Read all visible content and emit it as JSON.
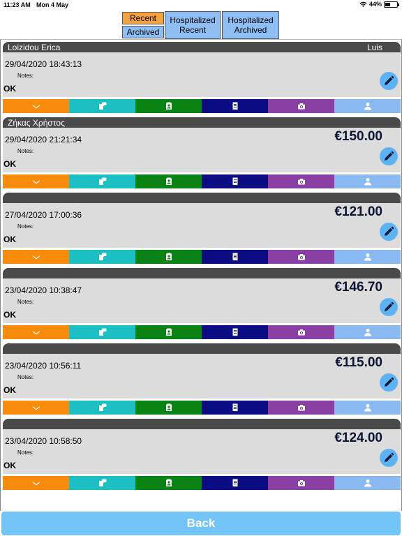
{
  "status_bar": {
    "time": "11:23 AM",
    "date": "Mon 4 May",
    "battery": "44%",
    "battery_level": 0.44,
    "wifi_icon": "wifi-icon"
  },
  "tabs": {
    "recent": "Recent",
    "archived": "Archived",
    "hospitalized_recent": [
      "Hospitalized",
      "Recent"
    ],
    "hospitalized_archived": [
      "Hospitalized",
      "Archived"
    ]
  },
  "cards": [
    {
      "name": "Loizidou Erica",
      "doctor": "Luis",
      "date": "29/04/2020 18:43:13",
      "notes_label": "Notes:",
      "status": "OK",
      "price": ""
    },
    {
      "name": "Ζήκας Χρήστος",
      "doctor": "",
      "date": "29/04/2020 21:21:34",
      "notes_label": "Notes:",
      "status": "OK",
      "price": "€150.00"
    },
    {
      "name": "",
      "doctor": "",
      "date": "27/04/2020 17:00:36",
      "notes_label": "Notes:",
      "status": "OK",
      "price": "€121.00"
    },
    {
      "name": "",
      "doctor": "",
      "date": "23/04/2020 10:38:47",
      "notes_label": "Notes:",
      "status": "OK",
      "price": "€146.70"
    },
    {
      "name": "",
      "doctor": "",
      "date": "23/04/2020 10:56:11",
      "notes_label": "Notes:",
      "status": "OK",
      "price": "€115.00"
    },
    {
      "name": "",
      "doctor": "",
      "date": "23/04/2020 10:58:50",
      "notes_label": "Notes:",
      "status": "OK",
      "price": "€124.00"
    }
  ],
  "action_icons": [
    "chevron-down-icon",
    "chat-icon",
    "user-badge-icon",
    "document-icon",
    "camera-icon",
    "person-icon"
  ],
  "action_colors": [
    "#f98b0d",
    "#1cc0c2",
    "#0a8214",
    "#0b0b82",
    "#8a3fa5",
    "#8bbaf2"
  ],
  "back_label": "Back"
}
